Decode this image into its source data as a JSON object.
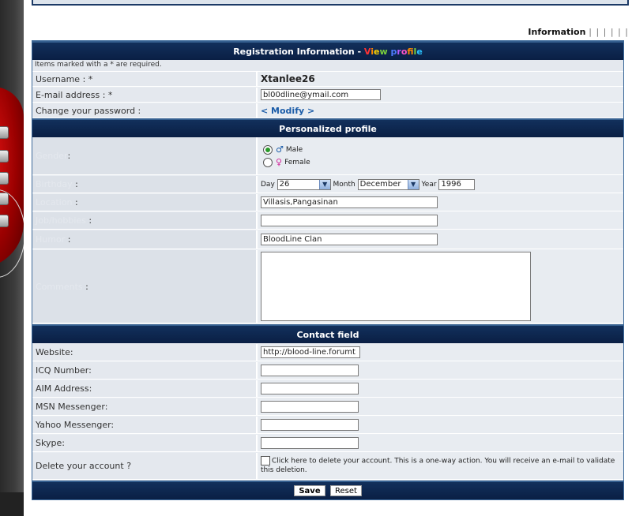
{
  "top": {
    "info_label": "Information",
    "info_bars": "| | | | | |"
  },
  "registration": {
    "header_title": "Registration Information - ",
    "header_link": [
      "V",
      "i",
      "e",
      "w",
      " ",
      "p",
      "r",
      "o",
      "f",
      "i",
      "l",
      "e"
    ],
    "required_note": "Items marked with a * are required.",
    "username_label": "Username : *",
    "username_value": "Xtanlee26",
    "email_label": "E-mail address : *",
    "email_value": "bl00dline@ymail.com",
    "password_label": "Change your password :",
    "password_link": "< Modify >"
  },
  "profile": {
    "header_title": "Personalized profile",
    "gender_label": "Gender",
    "gender_options": [
      "Male",
      "Female"
    ],
    "gender_selected": "Male",
    "birthday_label": "Birthday",
    "day_label": "Day",
    "day_value": "26",
    "month_label": "Month",
    "month_value": "December",
    "year_label": "Year",
    "year_value": "1996",
    "location_label": "Location",
    "location_value": "Villasis,Pangasinan",
    "job_label": "Job/hobbies",
    "job_value": "",
    "humor_label": "Humor",
    "humor_value": "BloodLine Clan",
    "comments_label": "Comments",
    "comments_value": ""
  },
  "contact": {
    "header_title": "Contact field",
    "website_label": "Website:",
    "website_value": "http://blood-line.forumt",
    "icq_label": "ICQ Number:",
    "aim_label": "AIM Address:",
    "msn_label": "MSN Messenger:",
    "yahoo_label": "Yahoo Messenger:",
    "skype_label": "Skype:",
    "delete_label": "Delete your account ?",
    "delete_text": "Click here to delete your account. This is a one-way action. You will receive an e-mail to validate this deletion."
  },
  "actions": {
    "save_label": "Save",
    "reset_label": "Reset"
  },
  "colors": {
    "header_bg": "#0a1f44",
    "link_blue": "#1b5ca8",
    "male_icon": "#1b5ca8",
    "female_icon": "#d0279a",
    "rainbow": [
      "#ff3333",
      "#ff8a00",
      "#ffd400",
      "#7bd13b",
      "#2ac3ff",
      "#4f7bff",
      "#b45cff",
      "#ff55c8",
      "#ff8a00",
      "#ffd400",
      "#7bd13b",
      "#2ac3ff"
    ]
  }
}
